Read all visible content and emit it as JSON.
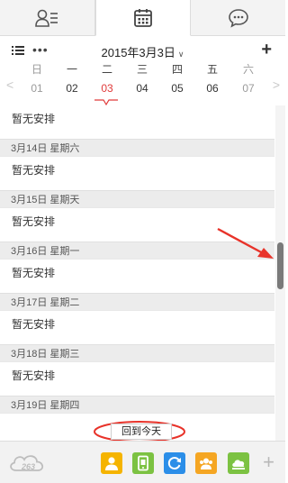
{
  "tabs": [
    {
      "icon": "contacts-icon",
      "active": false
    },
    {
      "icon": "calendar-icon",
      "active": true
    },
    {
      "icon": "chat-bubble-icon",
      "active": false
    }
  ],
  "toolbar": {
    "current_date": "2015年3月3日",
    "add_label": "+"
  },
  "week": {
    "days": [
      {
        "weekday": "日",
        "date": "01"
      },
      {
        "weekday": "一",
        "date": "02"
      },
      {
        "weekday": "二",
        "date": "03"
      },
      {
        "weekday": "三",
        "date": "04"
      },
      {
        "weekday": "四",
        "date": "05"
      },
      {
        "weekday": "五",
        "date": "06"
      },
      {
        "weekday": "六",
        "date": "07"
      }
    ]
  },
  "schedule": {
    "empty_text": "暂无安排",
    "headers": [
      "3月14日 星期六",
      "3月15日 星期天",
      "3月16日 星期一",
      "3月17日 星期二",
      "3月18日 星期三",
      "3月19日 星期四"
    ]
  },
  "today_button": "回到今天",
  "logo_text": "263",
  "colors": {
    "today_red": "#e03a3a",
    "annotation_red": "#e8332a",
    "app_yellow": "#f5b400",
    "app_green": "#7cc242",
    "app_blue": "#2b8ee8",
    "app_orange": "#f5a623"
  }
}
